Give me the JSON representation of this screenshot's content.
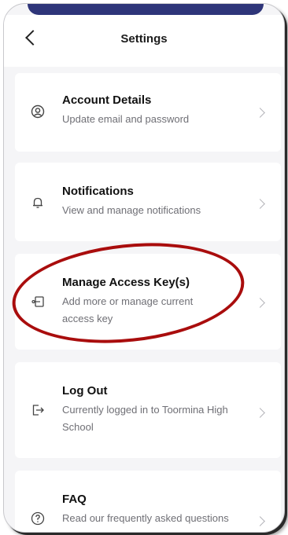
{
  "header": {
    "title": "Settings",
    "back_icon": "chevron-left-icon"
  },
  "items": [
    {
      "title": "Account Details",
      "subtitle": "Update email and password",
      "icon": "user-circle-icon"
    },
    {
      "title": "Notifications",
      "subtitle": "View and manage notifications",
      "icon": "bell-icon"
    },
    {
      "title": "Manage Access Key(s)",
      "subtitle": "Add more or manage current access key",
      "icon": "key-card-icon"
    },
    {
      "title": "Log Out",
      "subtitle": "Currently logged in to Toormina High School",
      "icon": "logout-icon"
    },
    {
      "title": "FAQ",
      "subtitle": "Read our frequently asked questions",
      "icon": "help-circle-icon"
    }
  ],
  "colors": {
    "accent_bar": "#2e3579",
    "annotation": "#a90d0d",
    "background": "#f5f5f7"
  }
}
